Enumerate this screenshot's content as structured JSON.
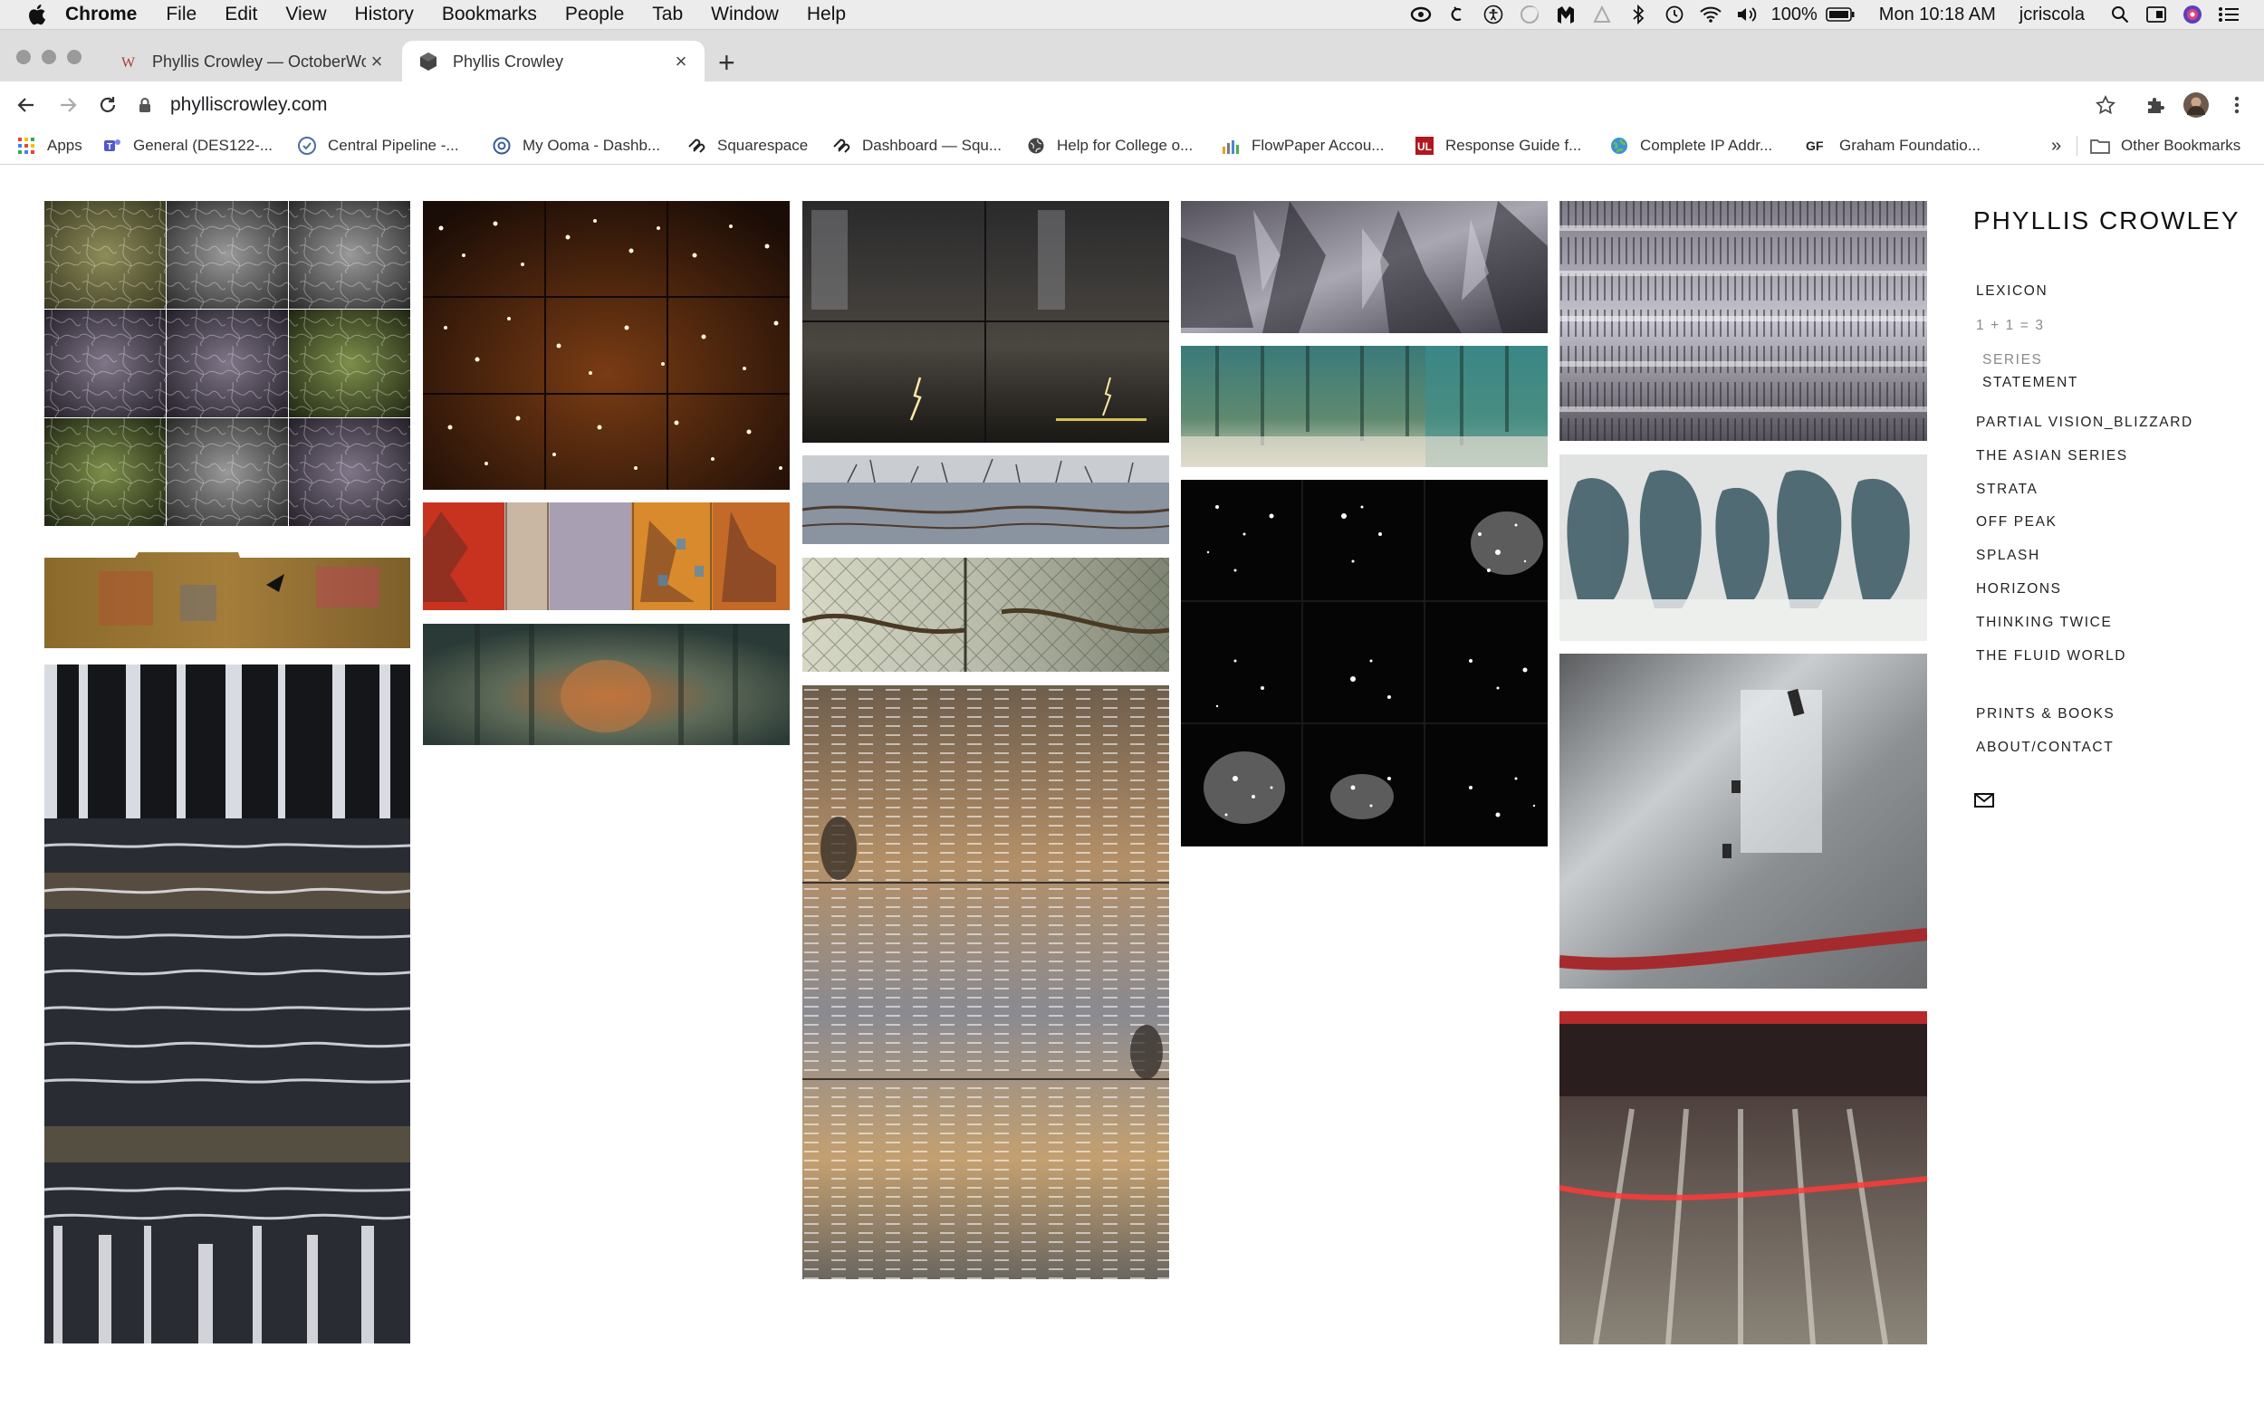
{
  "menubar": {
    "app_name": "Chrome",
    "items": [
      "File",
      "Edit",
      "View",
      "History",
      "Bookmarks",
      "People",
      "Tab",
      "Window",
      "Help"
    ],
    "battery": "100%",
    "clock": "Mon 10:18 AM",
    "user": "jcriscola"
  },
  "tabs": [
    {
      "title": "Phyllis Crowley — OctoberWor",
      "active": false
    },
    {
      "title": "Phyllis Crowley",
      "active": true
    }
  ],
  "omnibox": {
    "url": "phylliscrowley.com"
  },
  "bookmarks": {
    "items": [
      {
        "label": "Apps",
        "icon": "apps-grid-icon"
      },
      {
        "label": "General (DES122-...",
        "icon": "teams-icon"
      },
      {
        "label": "Central Pipeline -...",
        "icon": "pipeline-icon"
      },
      {
        "label": "My Ooma - Dashb...",
        "icon": "ooma-icon"
      },
      {
        "label": "Squarespace",
        "icon": "squarespace-icon"
      },
      {
        "label": "Dashboard — Squ...",
        "icon": "squarespace-icon"
      },
      {
        "label": "Help for College o...",
        "icon": "globe-icon"
      },
      {
        "label": "FlowPaper Accou...",
        "icon": "flowpaper-icon"
      },
      {
        "label": "Response Guide f...",
        "icon": "ul-icon"
      },
      {
        "label": "Complete IP Addr...",
        "icon": "globe-icon"
      },
      {
        "label": "Graham Foundatio...",
        "icon": "gf-icon"
      }
    ],
    "overflow": "»",
    "other": "Other Bookmarks"
  },
  "site": {
    "title": "PHYLLIS CROWLEY",
    "nav": {
      "lexicon": "LEXICON",
      "one_plus_one": "1 + 1 = 3",
      "series": "SERIES",
      "statement": "STATEMENT",
      "partial_vision": "PARTIAL VISION_BLIZZARD",
      "asian_series": "THE ASIAN SERIES",
      "strata": "STRATA",
      "off_peak": "OFF PEAK",
      "splash": "SPLASH",
      "horizons": "HORIZONS",
      "thinking_twice": "THINKING TWICE",
      "fluid_world": "THE FLUID WORLD",
      "prints_books": "PRINTS & BOOKS",
      "about_contact": "ABOUT/CONTACT"
    }
  },
  "gallery": {
    "columns": 5,
    "thumbnails": 16
  }
}
